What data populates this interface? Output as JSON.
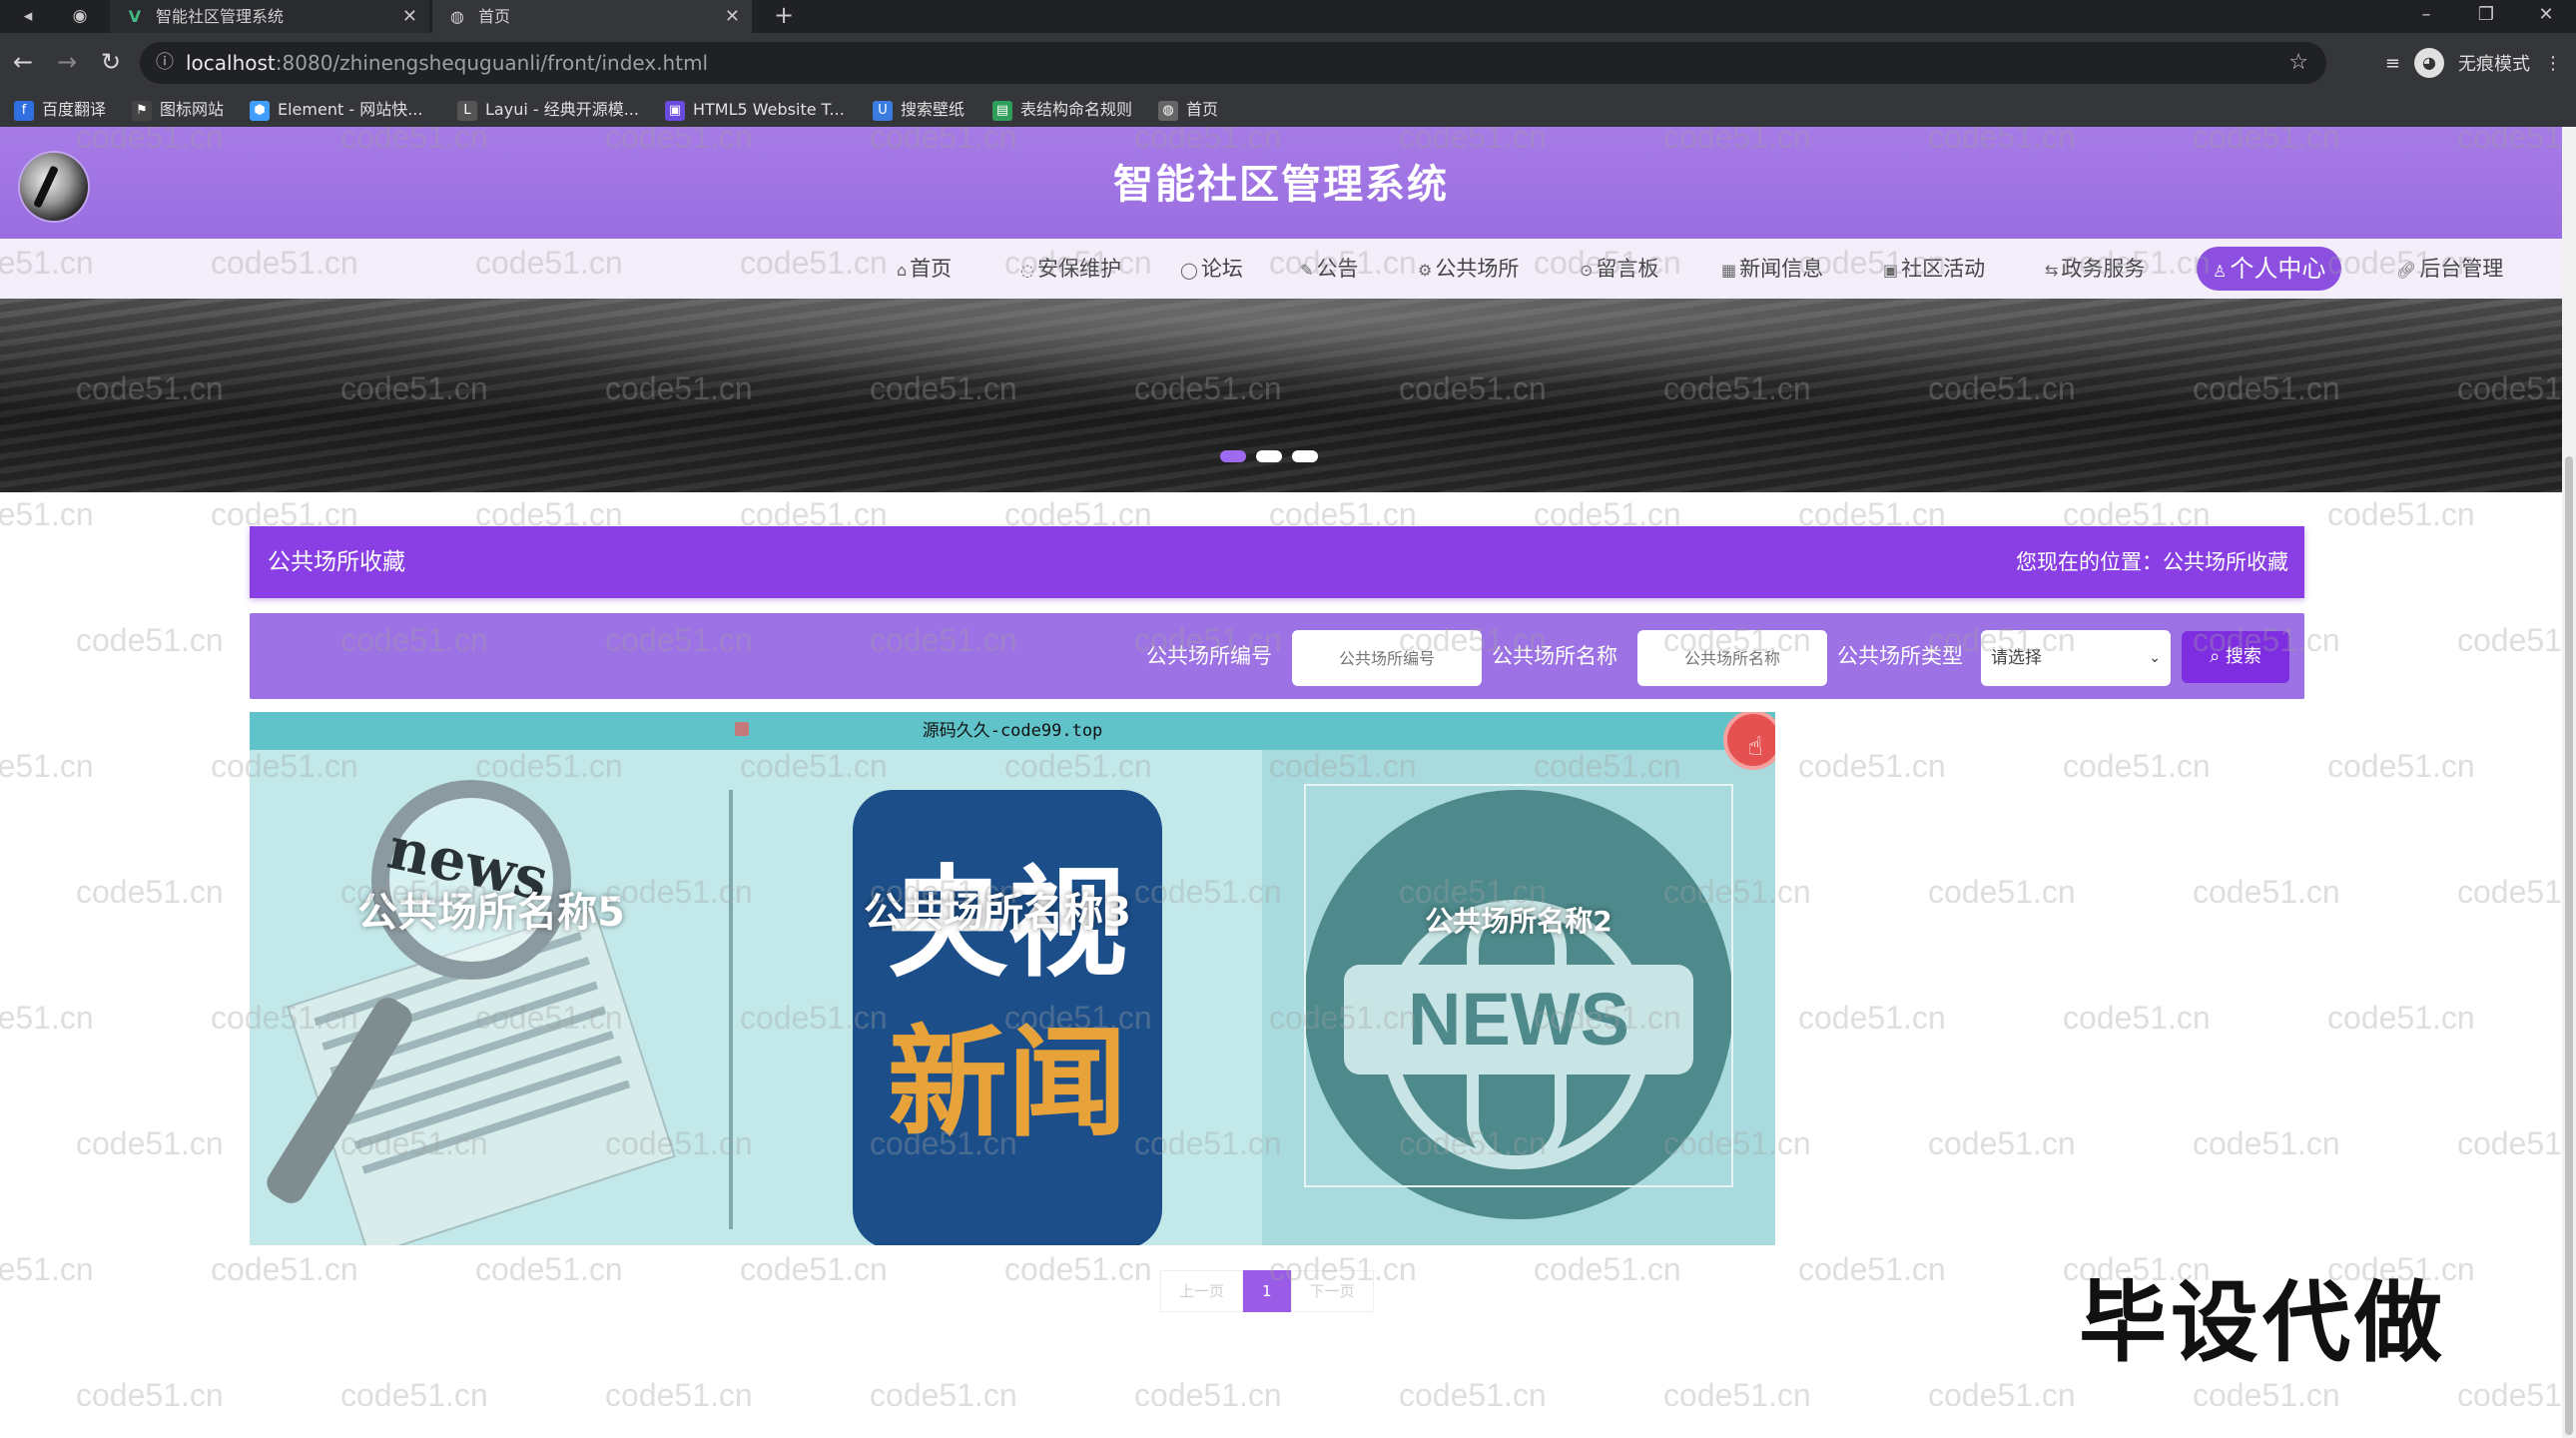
{
  "browser": {
    "tabs": [
      {
        "title": "智能社区管理系统",
        "favicon": "vue-v-icon",
        "active": false
      },
      {
        "title": "首页",
        "favicon": "globe-icon",
        "active": true
      }
    ],
    "url_host": "localhost",
    "url_path": ":8080/zhinengshequguanli/front/index.html",
    "incognito_label": "无痕模式",
    "bookmarks": [
      {
        "label": "百度翻译",
        "color": "#2f6fe0"
      },
      {
        "label": "图标网站",
        "color": "#444444"
      },
      {
        "label": "Element - 网站快...",
        "color": "#409eff"
      },
      {
        "label": "Layui - 经典开源模...",
        "color": "#555555"
      },
      {
        "label": "HTML5 Website T...",
        "color": "#6a4be0"
      },
      {
        "label": "搜索壁纸",
        "color": "#3a7be0"
      },
      {
        "label": "表结构命名规则",
        "color": "#2e9e5a"
      },
      {
        "label": "首页",
        "color": "#666666"
      }
    ]
  },
  "site": {
    "title": "智能社区管理系统",
    "nav": [
      {
        "label": "首页",
        "icon": "home-icon"
      },
      {
        "label": "安保维护",
        "icon": "shield-icon"
      },
      {
        "label": "论坛",
        "icon": "forum-icon"
      },
      {
        "label": "公告",
        "icon": "notice-icon"
      },
      {
        "label": "公共场所",
        "icon": "place-icon"
      },
      {
        "label": "留言板",
        "icon": "message-icon"
      },
      {
        "label": "新闻信息",
        "icon": "news-icon"
      },
      {
        "label": "社区活动",
        "icon": "activity-icon"
      },
      {
        "label": "政务服务",
        "icon": "service-icon"
      },
      {
        "label": "个人中心",
        "icon": "user-icon",
        "active": true
      },
      {
        "label": "后台管理",
        "icon": "link-icon"
      }
    ],
    "section_title": "公共场所收藏",
    "breadcrumb": "您现在的位置：公共场所收藏",
    "search": {
      "code_label": "公共场所编号",
      "code_placeholder": "公共场所编号",
      "name_label": "公共场所名称",
      "name_placeholder": "公共场所名称",
      "type_label": "公共场所类型",
      "type_selected": "请选择",
      "button_label": "搜索"
    },
    "ad_text": "源码久久-code99.top",
    "cards": [
      {
        "title": "公共场所名称5",
        "image_label": "news"
      },
      {
        "title": "公共场所名称3",
        "image_top": "央视",
        "image_bottom": "新闻"
      },
      {
        "title": "公共场所名称2",
        "image_label": "NEWS"
      }
    ],
    "pager": {
      "prev": "上一页",
      "current": "1",
      "next": "下一页"
    }
  },
  "overlay": {
    "watermark": "code51.cn",
    "stamp": "毕设代做"
  },
  "colors": {
    "header": "#9a6ee0",
    "accent": "#8a3fe4",
    "search_bar": "#9d72e4"
  }
}
